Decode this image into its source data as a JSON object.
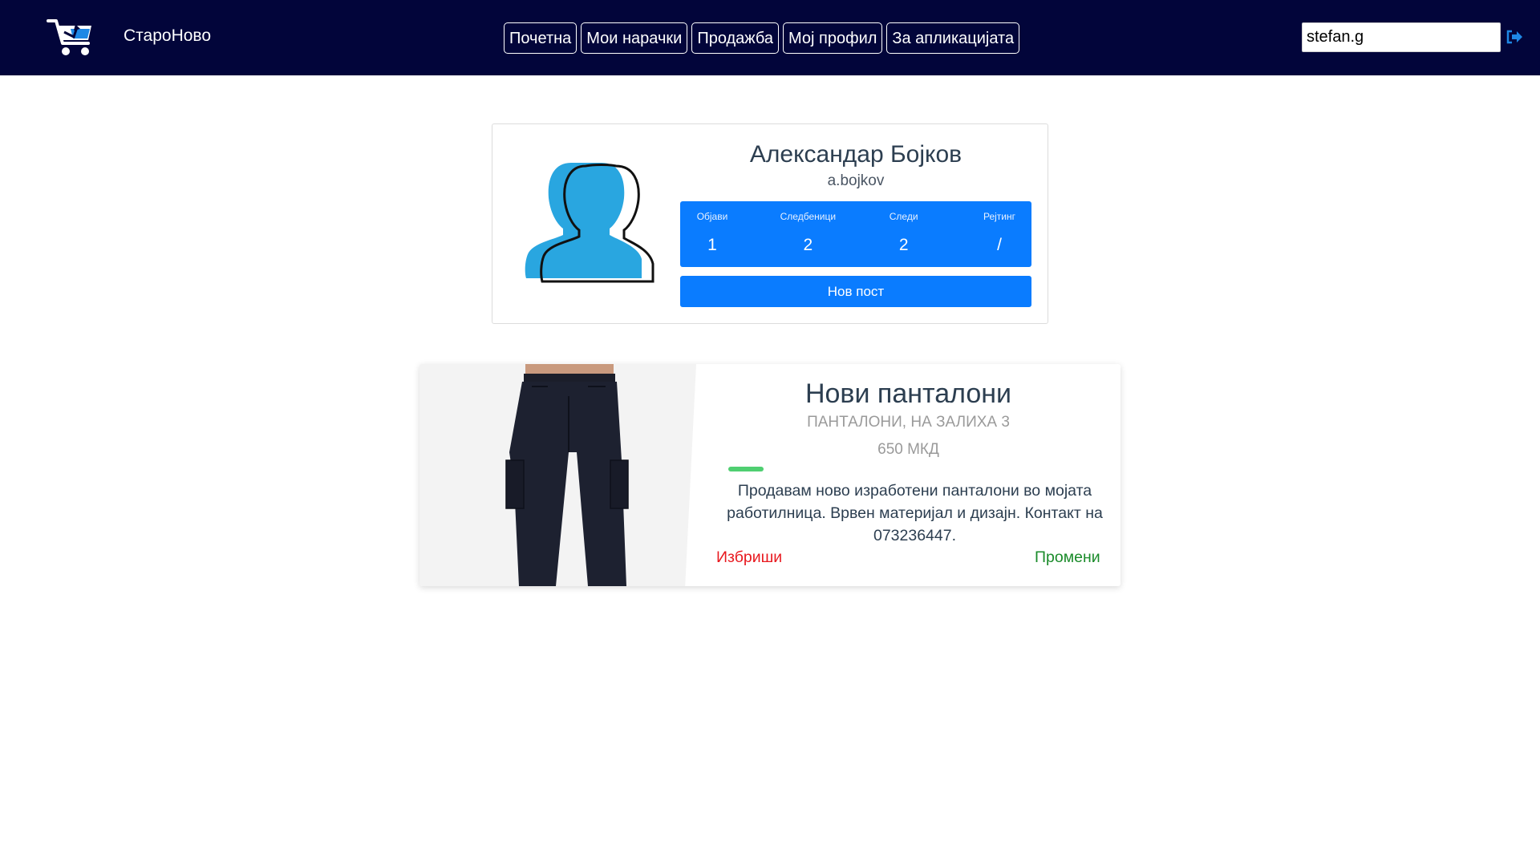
{
  "brand": {
    "name": "СтароНово",
    "logo_icon": "shopping-cart-icon"
  },
  "nav": {
    "items": [
      {
        "label": "Почетна"
      },
      {
        "label": "Мои нарачки"
      },
      {
        "label": "Продажба"
      },
      {
        "label": "Мој профил"
      },
      {
        "label": "За апликацијата"
      }
    ]
  },
  "user": {
    "username": "stefan.g",
    "logout_icon": "sign-out-icon"
  },
  "profile": {
    "name": "Александар Бојков",
    "username": "a.bojkov",
    "avatar_icon": "user-silhouette-icon",
    "stats": [
      {
        "label": "Објави",
        "value": "1"
      },
      {
        "label": "Следбеници",
        "value": "2"
      },
      {
        "label": "Следи",
        "value": "2"
      },
      {
        "label": "Рејтинг",
        "value": "/"
      }
    ],
    "new_post_label": "Нов пост"
  },
  "post": {
    "title": "Нови панталони",
    "meta": "ПАНТАЛОНИ, НА ЗАЛИХА 3",
    "price": "650 МКД",
    "description": "Продавам ново изработени панталони во мојата работилница. Врвен материјал и дизајн. Контакт на 073236447.",
    "delete_label": "Избриши",
    "edit_label": "Промени",
    "image_icon": "pants-image"
  },
  "colors": {
    "navbar": "#02053a",
    "primary": "#0a7cff",
    "accent_green": "#4fcf71",
    "delete_red": "#e8191f",
    "edit_green": "#1a8b2a"
  }
}
